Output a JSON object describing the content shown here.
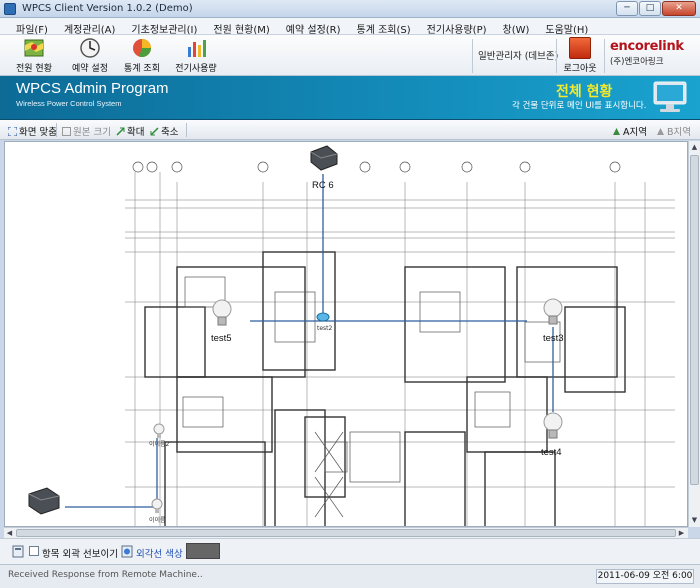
{
  "window": {
    "title": "WPCS Client Version 1.0.2 (Demo)",
    "minimize": "─",
    "maximize": "□",
    "close": "✕"
  },
  "menu": [
    "파일(F)",
    "계정관리(A)",
    "기초정보관리(I)",
    "전원 현황(M)",
    "예약 설정(R)",
    "통계 조회(S)",
    "전기사용량(P)",
    "창(W)",
    "도움말(H)"
  ],
  "toolbar": {
    "buttons": [
      {
        "label": "전원 현황",
        "icon": "map-icon"
      },
      {
        "label": "예약 설정",
        "icon": "clock-icon"
      },
      {
        "label": "통계 조회",
        "icon": "pie-chart-icon"
      },
      {
        "label": "전기사용량",
        "icon": "bar-chart-icon"
      }
    ],
    "admin_label": "일반관리자 (데브존)",
    "logout_label": "로그아웃",
    "logo_brand": "encorelink",
    "logo_sub": "(주)엔코아링크"
  },
  "banner": {
    "program_title": "WPCS Admin Program",
    "program_subtitle": "Wireless Power Control System",
    "page_title": "전체 현황",
    "page_desc": "각 건물 단위로 메인 UI를 표시합니다."
  },
  "viewbar": {
    "fit_label": "화면 맞춤",
    "original_label": "원본 크기",
    "zoom_in_label": "확대",
    "zoom_out_label": "축소",
    "area_a_label": "A지역",
    "area_b_label": "B지역"
  },
  "map": {
    "devices": [
      {
        "name": "RC 6",
        "type": "controller"
      },
      {
        "name": "test2",
        "type": "sensor"
      },
      {
        "name": "test5",
        "type": "bulb"
      },
      {
        "name": "test3",
        "type": "bulb"
      },
      {
        "name": "test4",
        "type": "bulb"
      },
      {
        "name": "이이름2",
        "type": "bulb"
      },
      {
        "name": "이이름",
        "type": "bulb"
      }
    ],
    "link_color": "#2f5f9e"
  },
  "bottom": {
    "show_outline_label": "항목 외곽 선보이기",
    "outline_color_label": "외각선 색상",
    "outline_color": "#666666"
  },
  "status": {
    "message": "Received Response from Remote Machine..",
    "datetime": "2011-06-09 오전 6:00"
  }
}
